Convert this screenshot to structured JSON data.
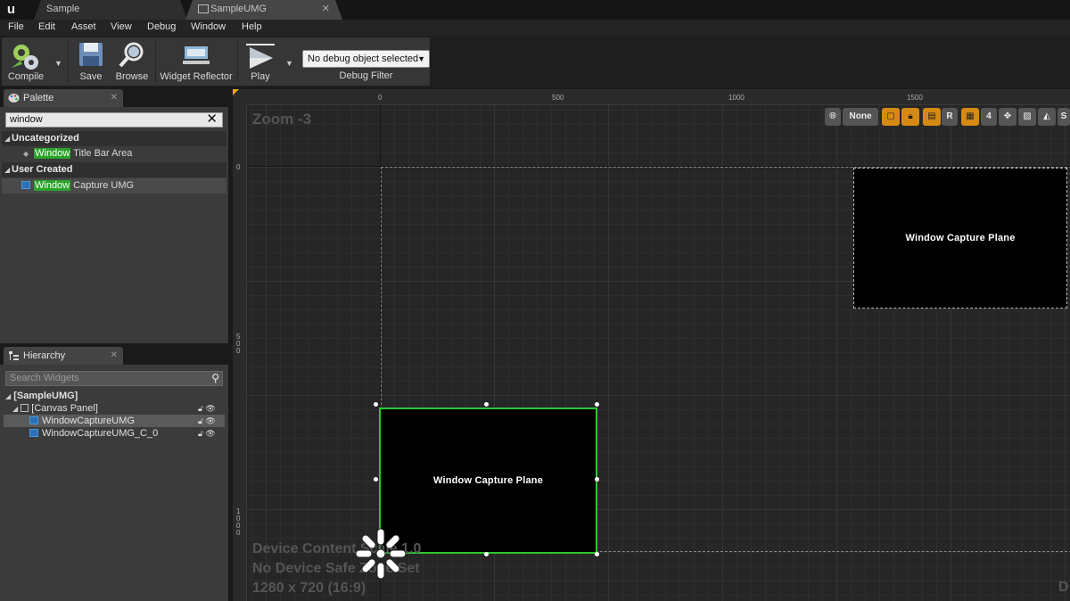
{
  "tabs": {
    "doc_tab_1": "Sample",
    "doc_tab_2": "SampleUMG"
  },
  "menu": [
    "File",
    "Edit",
    "Asset",
    "View",
    "Debug",
    "Window",
    "Help"
  ],
  "toolbar": {
    "compile": "Compile",
    "save": "Save",
    "browse": "Browse",
    "widget_reflector": "Widget Reflector",
    "play": "Play",
    "debug_object": "No debug object selected",
    "debug_filter": "Debug Filter"
  },
  "palette": {
    "tab": "Palette",
    "search_value": "window",
    "categories": [
      {
        "name": "Uncategorized",
        "items": [
          {
            "match": "Window",
            "rest": " Title Bar Area"
          }
        ]
      },
      {
        "name": "User Created",
        "items": [
          {
            "match": "Window",
            "rest": " Capture UMG"
          }
        ]
      }
    ]
  },
  "hierarchy": {
    "tab": "Hierarchy",
    "search_placeholder": "Search Widgets",
    "root": "[SampleUMG]",
    "canvas": "[Canvas Panel]",
    "children": [
      "WindowCaptureUMG",
      "WindowCaptureUMG_C_0"
    ]
  },
  "designer": {
    "zoom": "Zoom -3",
    "ruler_top": [
      "0",
      "500",
      "1000",
      "1500"
    ],
    "ruler_left": [
      "0",
      "500",
      "1000"
    ],
    "toolbar": {
      "none": "None",
      "r": "R",
      "grid_size": "4",
      "s": "S"
    },
    "plane_label_1": "Window Capture Plane",
    "plane_label_2": "Window Capture Plane",
    "device_content_scale": "Device Content Scale 1.0",
    "safe_zone": "No Device Safe Zone Set",
    "resolution": "1280 x 720 (16:9)",
    "edge_glyph": "D"
  },
  "colors": {
    "highlight": "#29a329",
    "selection_border": "#2ec72e",
    "accent_orange": "#d68a14"
  }
}
